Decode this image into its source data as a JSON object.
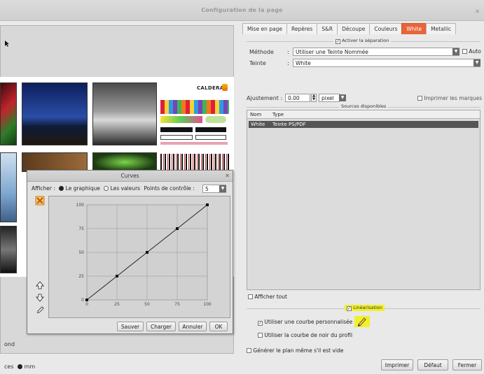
{
  "window": {
    "title": "Configuration de la page"
  },
  "preview": {
    "bottom_left_text": "ond",
    "bottom_status_text": "ces",
    "bottom_status_unit": "mm",
    "logo_text": "CALDERA"
  },
  "curves": {
    "title": "Curves",
    "afficher_label": "Afficher :",
    "radio_graph": "Le graphique",
    "radio_values": "Les valeurs",
    "control_points_label": "Points de contrôle :",
    "control_points_value": "5",
    "x_ticks": [
      "0",
      "25",
      "50",
      "75",
      "100"
    ],
    "y_ticks": [
      "100",
      "75",
      "50",
      "25",
      "0"
    ],
    "buttons": {
      "save": "Sauver",
      "load": "Charger",
      "cancel": "Annuler",
      "ok": "OK"
    }
  },
  "chart_data": {
    "type": "line",
    "x": [
      0,
      25,
      50,
      75,
      100
    ],
    "series": [
      {
        "values": [
          0,
          25,
          50,
          75,
          100
        ]
      }
    ],
    "xlim": [
      0,
      100
    ],
    "ylim": [
      0,
      100
    ],
    "grid": true
  },
  "tabs": [
    "Mise en page",
    "Repères",
    "S&R",
    "Découpe",
    "Couleurs",
    "White",
    "Metallic"
  ],
  "active_tab": "White",
  "separation": {
    "legend": "Activer la séparation",
    "method_label": "Méthode",
    "method_value": "Utiliser une Teinte Nommée",
    "auto_label": "Auto",
    "tint_label": "Teinte",
    "tint_value": "White"
  },
  "adjust": {
    "label": "Ajustement :",
    "value": "0.00",
    "unit": "pixel",
    "print_marks_label": "Imprimer les marques"
  },
  "sources": {
    "legend": "Sources disponibles",
    "col_name": "Nom",
    "col_type": "Type",
    "rows": [
      {
        "name": "White",
        "type": "Teinte PS/PDF"
      }
    ],
    "show_all_label": "Afficher tout"
  },
  "linearisation": {
    "legend": "Linéarisation",
    "custom_curve_label": "Utiliser une courbe personnalisée",
    "profile_black_label": "Utiliser la courbe de noir du profil"
  },
  "generate_empty_label": "Générer le plan même s'il est vide",
  "footer_buttons": {
    "print": "Imprimer",
    "default": "Défaut",
    "close": "Fermer"
  },
  "colors": {
    "accent_tab": "#e8643a",
    "highlight": "#f1f02a",
    "selection": "#555555"
  }
}
